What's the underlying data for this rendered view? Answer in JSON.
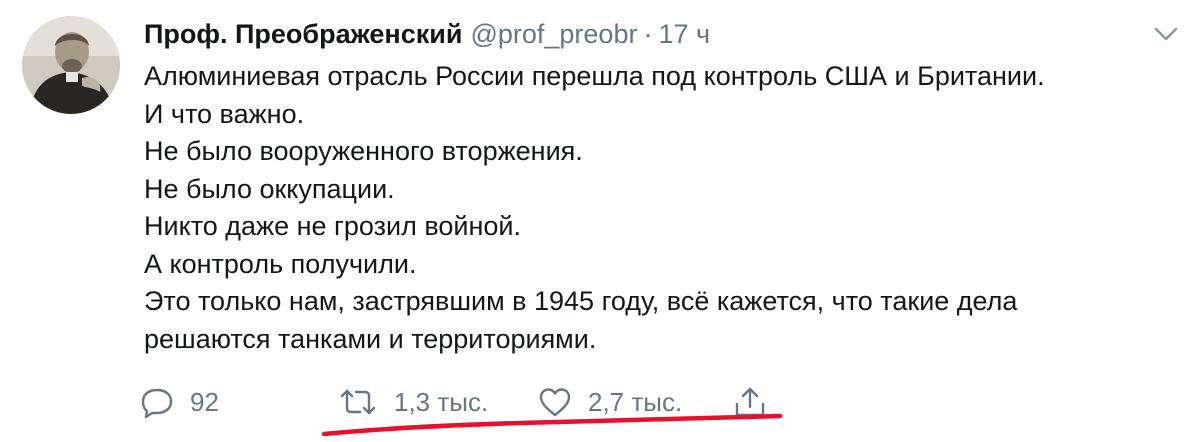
{
  "tweet": {
    "author_name": "Проф. Преображенский",
    "author_handle": "@prof_preobr",
    "separator": "·",
    "timestamp": "17 ч",
    "text_lines": [
      "Алюминиевая отрасль России перешла под контроль США и Британии.",
      "И что важно.",
      "Не было вооруженного вторжения.",
      "Не было оккупации.",
      "Никто даже не грозил войной.",
      "А контроль получили.",
      "Это только нам, застрявшим в 1945 году, всё кажется, что такие дела",
      "решаются танками и территориями."
    ]
  },
  "actions": {
    "reply": {
      "icon": "reply-icon",
      "count": "92"
    },
    "retweet": {
      "icon": "retweet-icon",
      "count": "1,3 тыс."
    },
    "like": {
      "icon": "heart-icon",
      "count": "2,7 тыс."
    },
    "share": {
      "icon": "share-icon"
    }
  },
  "menu": {
    "icon": "chevron-down-icon"
  },
  "annotation": {
    "type": "red-hand-drawn-underline",
    "color": "#e8112d"
  },
  "colors": {
    "text": "#14171a",
    "secondary": "#657786",
    "background": "#ffffff"
  }
}
